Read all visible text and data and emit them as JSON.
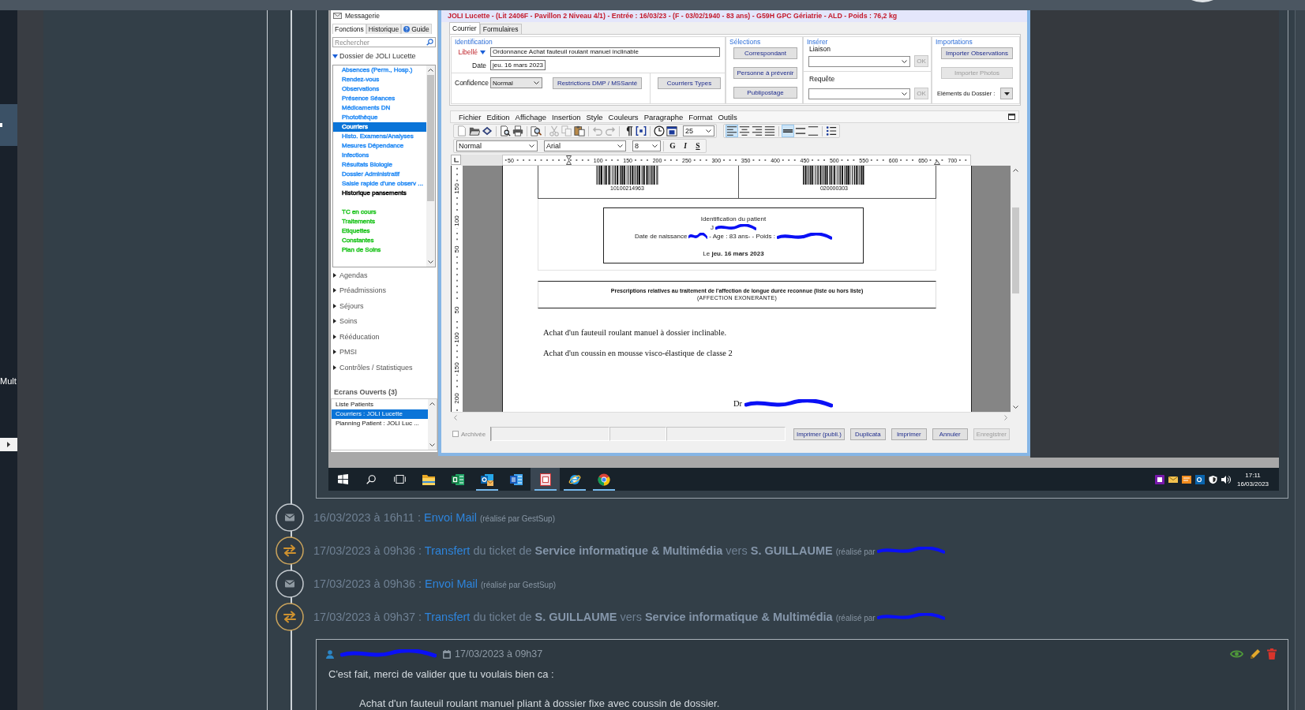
{
  "left_nav": {
    "items": [
      {
        "kind": "icon",
        "selected": true
      },
      {
        "kind": "label",
        "label": "Mult",
        "selected": false
      }
    ]
  },
  "screenshot": {
    "side_panel": {
      "title": "Messagerie",
      "tabs": [
        {
          "label": "Fonctions",
          "selected": true
        },
        {
          "label": "Historique",
          "selected": false
        },
        {
          "label": "Guide",
          "selected": false
        }
      ],
      "search": {
        "placeholder": "Rechercher"
      },
      "folder": {
        "label": "Dossier de JOLI Lucette",
        "expanded": true
      },
      "item_groups": [
        {
          "items": [
            {
              "label": "Absences (Perm., Hosp.)",
              "color": "#2b8ef5",
              "selected": false
            },
            {
              "label": "Rendez-vous",
              "color": "#2b8ef5",
              "selected": false
            },
            {
              "label": "Observations",
              "color": "#2b8ef5",
              "selected": false
            },
            {
              "label": "Présence Séances",
              "color": "#2b8ef5",
              "selected": false
            },
            {
              "label": "Médicaments DN",
              "color": "#2b8ef5",
              "selected": false
            },
            {
              "label": "Photothèque",
              "color": "#2b8ef5",
              "selected": false
            },
            {
              "label": "Courriers",
              "selected": true
            },
            {
              "label": "Histo. Examens/Analyses",
              "color": "#2b8ef5",
              "selected": false
            },
            {
              "label": "Mesures Dépendance",
              "color": "#2b8ef5",
              "selected": false
            },
            {
              "label": "Infections",
              "color": "#2b8ef5",
              "selected": false
            },
            {
              "label": "Résultats Biologie",
              "color": "#2b8ef5",
              "selected": false
            },
            {
              "label": "Dossier Administratif",
              "color": "#2b8ef5",
              "selected": false
            },
            {
              "label": "Saisie rapide d'une observ ...",
              "color": "#2b8ef5",
              "selected": false
            },
            {
              "label": "Historique pansements",
              "color": "#000000",
              "selected": false
            }
          ]
        },
        {
          "items": [
            {
              "label": "TC en cours",
              "color": "#1fc41f",
              "selected": false
            },
            {
              "label": "Traitements",
              "color": "#1fc41f",
              "selected": false
            },
            {
              "label": "Etiquettes",
              "color": "#1fc41f",
              "selected": false
            },
            {
              "label": "Constantes",
              "color": "#1fc41f",
              "selected": false
            },
            {
              "label": "Plan de Soins",
              "color": "#1fc41f",
              "selected": false
            }
          ]
        }
      ],
      "sections": [
        {
          "label": "Agendas",
          "expanded": false
        },
        {
          "label": "Préadmissions",
          "expanded": false
        },
        {
          "label": "Séjours",
          "expanded": false
        },
        {
          "label": "Soins",
          "expanded": false
        },
        {
          "label": "Rééducation",
          "expanded": false
        },
        {
          "label": "PMSI",
          "expanded": false
        },
        {
          "label": "Contrôles / Statistiques",
          "expanded": false
        }
      ],
      "open_screens": {
        "title": "Ecrans Ouverts (3)",
        "items": [
          {
            "label": "Liste Patients",
            "selected": false
          },
          {
            "label": "Courriers : JOLI Lucette",
            "selected": true
          },
          {
            "label": "Planning Patient : JOLI Luc ...",
            "selected": false
          }
        ]
      }
    },
    "dialog": {
      "title": "JOLI Lucette - (Lit 2406F - Pavillon 2 Niveau 4/1) - Entrée : 16/03/23 - (F - 03/02/1940 - 83 ans) - G59H GPC Gériatrie - ALD - Poids : 76,2 kg",
      "tabs": [
        {
          "label": "Courrier",
          "selected": true
        },
        {
          "label": "Formulaires",
          "selected": false
        }
      ],
      "identification": {
        "legend": "Identification",
        "title_label": "Libellé",
        "title_value": "Ordonnance Achat fauteuil roulant manuel inclinable",
        "date_label": "Date",
        "date_value": "jeu. 16 mars 2023",
        "confidence_label": "Confidence",
        "confidence_value": "Normal",
        "restrictions_button": "Restrictions DMP / MSSanté",
        "templates_button": "Courriers Types"
      },
      "selections": {
        "legend": "Sélections",
        "buttons": [
          "Correspondant",
          "Personne à prévenir",
          "Publipostage"
        ]
      },
      "insert": {
        "legend": "Insérer",
        "rows": [
          {
            "label": "Liaison",
            "button": "OK",
            "disabled": true
          },
          {
            "label": "Requête",
            "button": "OK",
            "disabled": true
          }
        ]
      },
      "imports": {
        "legend": "Importations",
        "buttons": [
          {
            "label": "Importer Observations",
            "disabled": false
          },
          {
            "label": "Importer Photos",
            "disabled": true
          }
        ],
        "elements_label": "Eléments du Dossier :"
      },
      "menu": [
        "Fichier",
        "Edition",
        "Affichage",
        "Insertion",
        "Style",
        "Couleurs",
        "Paragraphe",
        "Format",
        "Outils"
      ],
      "toolbar": [
        {
          "buttons": [
            {
              "kind": "new",
              "disabled": false
            },
            {
              "kind": "open",
              "disabled": false
            },
            {
              "kind": "save",
              "disabled": false
            }
          ]
        },
        {
          "buttons": [
            {
              "kind": "preview",
              "disabled": false
            },
            {
              "kind": "print",
              "disabled": false
            }
          ]
        },
        {
          "buttons": [
            {
              "kind": "find",
              "disabled": false
            }
          ]
        },
        {
          "buttons": [
            {
              "kind": "cut",
              "disabled": true
            },
            {
              "kind": "copy",
              "disabled": true
            },
            {
              "kind": "paste",
              "disabled": false
            }
          ]
        },
        {
          "buttons": [
            {
              "kind": "undo",
              "disabled": true
            },
            {
              "kind": "redo",
              "disabled": true
            }
          ]
        },
        {
          "buttons": [
            {
              "kind": "pilcrow",
              "disabled": false
            },
            {
              "kind": "field",
              "disabled": false
            }
          ]
        },
        {
          "buttons": [
            {
              "kind": "clock",
              "disabled": false
            },
            {
              "kind": "calendar",
              "disabled": false
            }
          ]
        }
      ],
      "zoom": "25",
      "format_toolbar": [
        {
          "buttons": [
            {
              "kind": "align-left",
              "selected": true
            },
            {
              "kind": "align-center",
              "selected": false
            },
            {
              "kind": "align-right",
              "selected": false
            },
            {
              "kind": "justify",
              "selected": false
            }
          ]
        },
        {
          "buttons": [
            {
              "kind": "spacing-single",
              "selected": true
            },
            {
              "kind": "spacing-half",
              "selected": false
            },
            {
              "kind": "spacing-double",
              "selected": false
            }
          ]
        },
        {
          "buttons": [
            {
              "kind": "bullets",
              "selected": false
            }
          ]
        }
      ],
      "style_select": "Normal",
      "font_select": "Arial",
      "size_select": "8",
      "text_buttons": [
        {
          "label": "G",
          "kind": "bold"
        },
        {
          "label": "I",
          "kind": "italic"
        },
        {
          "label": "S",
          "kind": "underline"
        }
      ],
      "ruler": [
        "50",
        "100",
        "150",
        "200",
        "250",
        "300",
        "350",
        "400",
        "450",
        "500",
        "550",
        "600",
        "650",
        "700"
      ],
      "vertical_ruler": [
        "150",
        "100",
        "50",
        "50",
        "100",
        "150",
        "200"
      ],
      "document": {
        "barcodes": [
          "10100214963",
          "020000303"
        ],
        "patient_title": "Identification du patient",
        "patient_initial": "J",
        "birth_label": "Date de naissance",
        "age_weight": "- Age : 83 ans- - Poids :",
        "date_line": "Le **jeu. 16 mars 2023**",
        "prescription_title": "Prescriptions relatives au traitement de l'affection de longue durée reconnue (liste ou hors liste)",
        "prescription_subtitle": "(AFFECTION EXONERANTE)",
        "lines": [
          "Achat d'un fauteuil roulant manuel à dossier inclinable.",
          "Achat d'un coussin en mousse visco-élastique de classe 2"
        ],
        "signature": "Dr"
      },
      "status": {
        "archived_label": "Archivée",
        "archived": false,
        "buttons": [
          {
            "label": "Imprimer (publi.)",
            "disabled": false
          },
          {
            "label": "Duplicata",
            "disabled": false
          },
          {
            "label": "Imprimer",
            "disabled": false
          },
          {
            "label": "Annuler",
            "disabled": false
          },
          {
            "label": "Enregistrer",
            "disabled": true
          }
        ]
      }
    },
    "taskbar": {
      "apps": [
        {
          "kind": "folder",
          "running": false,
          "selected": false
        },
        {
          "kind": "spreadsheet",
          "running": false,
          "selected": false
        },
        {
          "kind": "mail",
          "running": true,
          "selected": false
        },
        {
          "kind": "word",
          "running": false,
          "selected": false
        },
        {
          "kind": "record",
          "running": true,
          "selected": true
        },
        {
          "kind": "browser",
          "running": true,
          "selected": false
        },
        {
          "kind": "browser-round",
          "running": true,
          "selected": false
        }
      ],
      "time": "17:11",
      "date": "16/03/2023"
    }
  },
  "history": [
    {
      "kind": "mail",
      "date": "16/03/2023 à 16h11 :",
      "action": "Envoi Mail",
      "note": "(réalisé par GestSup)",
      "redacted": false
    },
    {
      "kind": "transfer",
      "date": "17/03/2023 à 09h36 :",
      "action": "Transfert",
      "text": "du ticket de **Service informatique & Multimédia** vers **S. GUILLAUME**",
      "note": "(réalisé par",
      "redacted": true
    },
    {
      "kind": "mail",
      "date": "17/03/2023 à 09h36 :",
      "action": "Envoi Mail",
      "note": "(réalisé par GestSup)",
      "redacted": false
    },
    {
      "kind": "transfer",
      "date": "17/03/2023 à 09h37 :",
      "action": "Transfert",
      "text": "du ticket de **S. GUILLAUME** vers **Service informatique & Multimédia**",
      "note": "(réalisé par",
      "redacted": true
    }
  ],
  "comment": {
    "author_redacted": true,
    "date": "17/03/2023 à 09h37",
    "text": "C'est fait, merci de valider que tu voulais bien ca :",
    "quote": "Achat d'un fauteuil roulant manuel pliant à dossier fixe avec coussin de dossier."
  }
}
